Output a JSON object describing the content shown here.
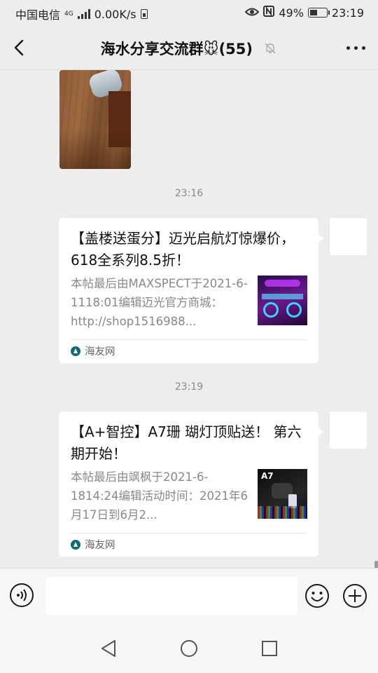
{
  "status_bar": {
    "carrier": "中国电信",
    "network": "4G",
    "speed": "0.00K/s",
    "battery_percent": "49%",
    "battery_level": 0.49,
    "time": "23:19"
  },
  "header": {
    "title": "海水分享交流群🐭(55)",
    "icons": [
      "back-icon",
      "mute-bell-icon",
      "more-icon"
    ]
  },
  "messages": [
    {
      "type": "image",
      "sender": "other"
    },
    {
      "type": "timestamp",
      "text": "23:16"
    },
    {
      "type": "link_card",
      "sender": "self",
      "title": "【盖楼送蛋分】迈光启航灯惊爆价，618全系列8.5折！",
      "desc": "本帖最后由MAXSPECT于2021-6-1118:01编辑迈光官方商城：http://shop1516988...",
      "source": "海友网"
    },
    {
      "type": "timestamp",
      "text": "23:19"
    },
    {
      "type": "link_card",
      "sender": "self",
      "title": "【A+智控】A7珊 瑚灯顶贴送！ 第六期开始！",
      "desc": "本帖最后由飒枫于2021-6-1814:24编辑活动时间：2021年6月17日到6月2...",
      "source": "海友网",
      "thumb_label": "A7"
    }
  ],
  "input_bar": {
    "placeholder": "",
    "icons": [
      "voice-icon",
      "emoji-icon",
      "plus-icon"
    ]
  },
  "nav_bar": {
    "icons": [
      "nav-back-icon",
      "nav-home-icon",
      "nav-recent-icon"
    ]
  }
}
